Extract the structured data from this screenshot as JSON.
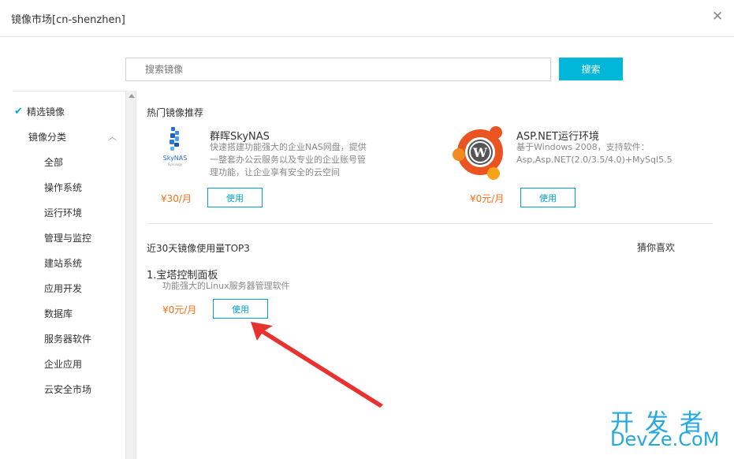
{
  "dialog": {
    "title": "镜像市场[cn-shenzhen]",
    "close_glyph": "✕"
  },
  "search": {
    "placeholder": "搜索镜像",
    "value": "",
    "button_label": "搜索"
  },
  "sidebar": {
    "featured_label": "精选镜像",
    "category_label": "镜像分类",
    "items": [
      "全部",
      "操作系统",
      "运行环境",
      "管理与监控",
      "建站系统",
      "应用开发",
      "数据库",
      "服务器软件",
      "企业应用",
      "云安全市场"
    ]
  },
  "hot": {
    "title": "热门镜像推荐",
    "cards": [
      {
        "name": "群晖SkyNAS",
        "desc_lines": [
          "快速搭建功能强大的企业NAS网盘，提供",
          "一整套办公云服务以及专业的企业账号管",
          "理功能，让企业享有安全的云空间"
        ],
        "price": "¥30/月",
        "button_label": "使用",
        "logo_text": "SkyNAS",
        "logo_subtext": "Synology",
        "icon": "skynas-logo-icon"
      },
      {
        "name": "ASP.NET运行环境",
        "desc_lines": [
          "基于Windows 2008，支持软件：",
          "Asp,Asp.NET(2.0/3.5/4.0)+MySql5.5"
        ],
        "price": "¥0元/月",
        "button_label": "使用",
        "icon": "ubuntu-wordpress-logo-icon"
      }
    ]
  },
  "top3": {
    "title": "近30天镜像使用量TOP3",
    "guess_label": "猜你喜欢",
    "items": [
      {
        "name": "1.宝塔控制面板",
        "desc": "功能强大的Linux服务器管理软件",
        "price": "¥0元/月",
        "button_label": "使用"
      }
    ]
  },
  "annotation": {
    "arrow_color": "#e8322f"
  },
  "watermark": {
    "line1": "开发者",
    "line2": "DevZe.CoM"
  },
  "colors": {
    "accent": "#00b7da",
    "price": "#f46f16",
    "link_blue": "#00a2d4"
  }
}
